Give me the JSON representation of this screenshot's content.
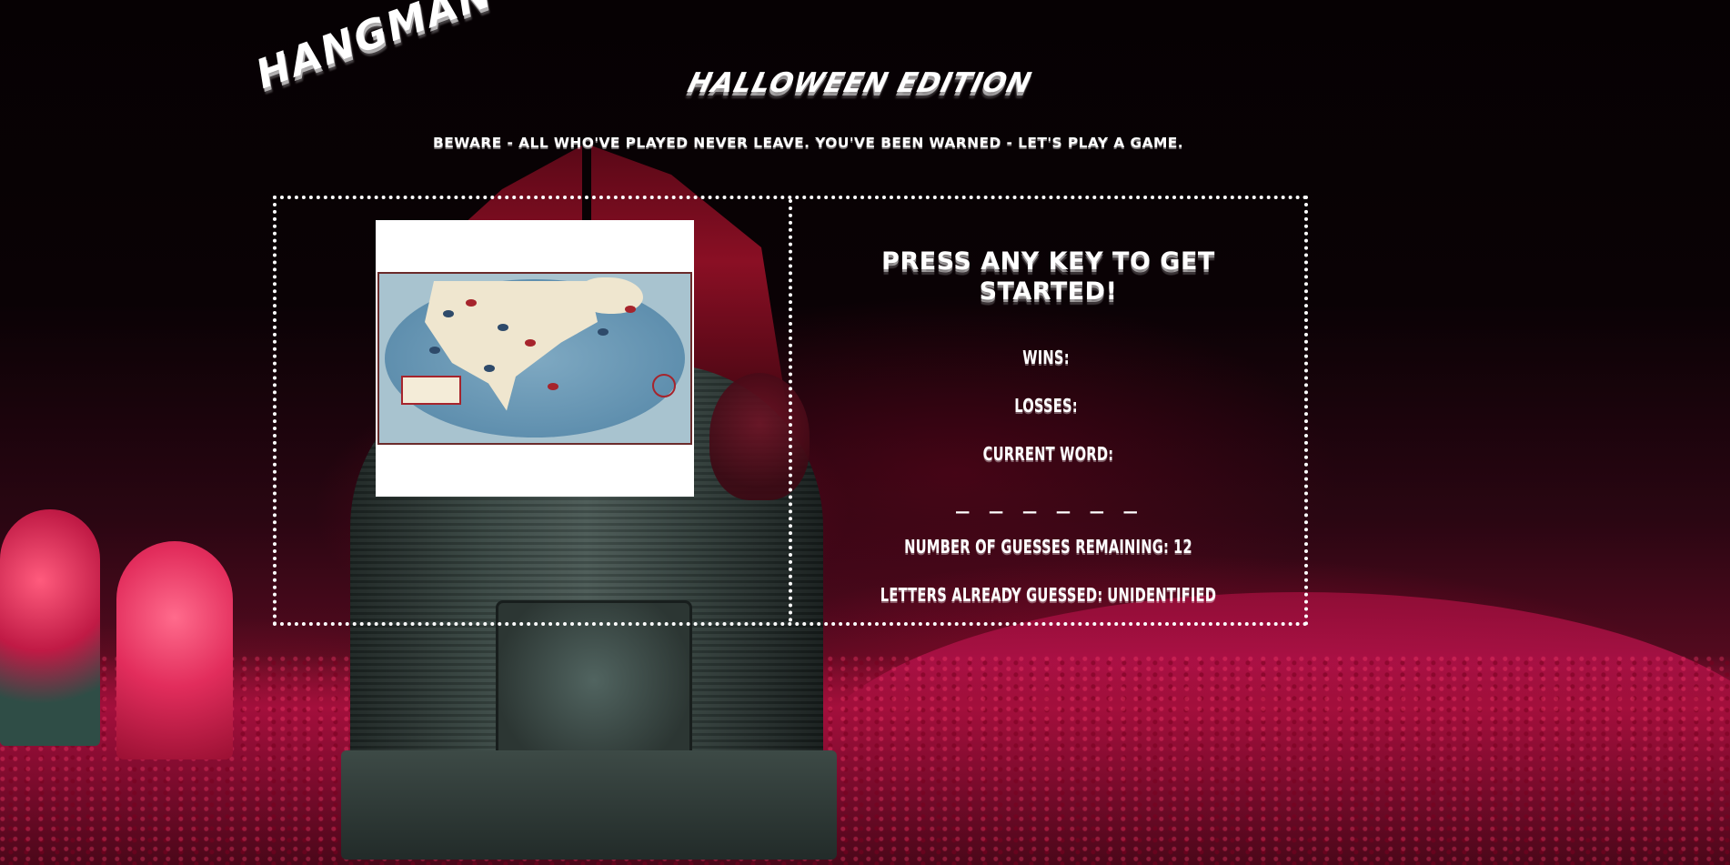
{
  "header": {
    "title": "HANGMAN",
    "subtitle": "HALLOWEEN EDITION",
    "warning": "BEWARE - ALL WHO'VE PLAYED NEVER LEAVE. YOU'VE BEEN WARNED - LET'S PLAY A GAME."
  },
  "game": {
    "prompt": "PRESS ANY KEY TO GET STARTED!",
    "wins_label": "WINS:",
    "wins_value": "",
    "losses_label": "LOSSES:",
    "losses_value": "",
    "current_word_label": "CURRENT WORD:",
    "current_word_display": "_ _ _ _ _ _",
    "guesses_remaining_label": "NUMBER OF GUESSES REMAINING:",
    "guesses_remaining_value": "12",
    "letters_guessed_label": "LETTERS ALREADY GUESSED:",
    "letters_guessed_value": "UNIDENTIFIED"
  },
  "image": {
    "icon": "north-america-map-icon",
    "map_label": "North America"
  },
  "colors": {
    "text": "#ffffff",
    "frame_border": "#ffffff",
    "background_dark": "#050104",
    "ground_red": "#a30f3c"
  }
}
